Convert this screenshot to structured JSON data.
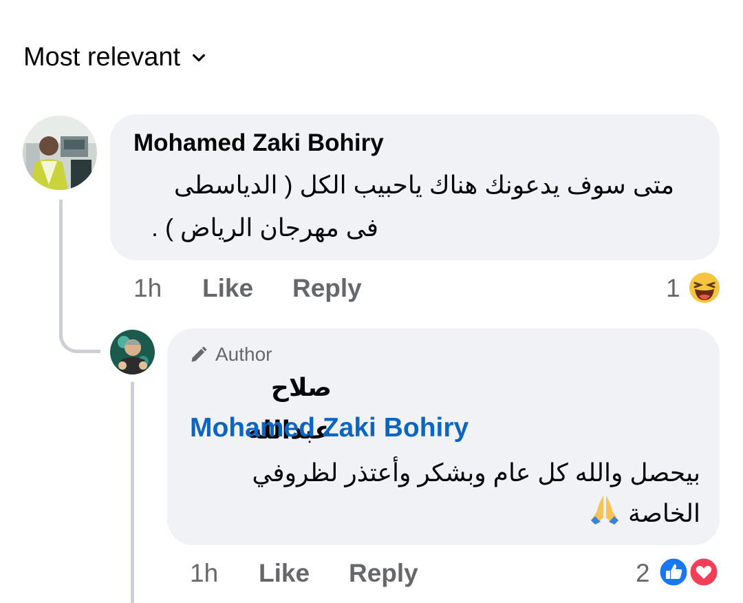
{
  "sort": {
    "label": "Most relevant"
  },
  "comment": {
    "author": "Mohamed Zaki Bohiry",
    "text_line1": "متى سوف يدعونك هناك ياحبيب الكل  ( الدياسطى",
    "text_line2": "فى مهرجان الرياض ) .",
    "time": "1h",
    "like_label": "Like",
    "reply_label": "Reply",
    "reaction_count": "1",
    "reactions": [
      "laugh-emoji"
    ]
  },
  "reply": {
    "badge_label": "Author",
    "author": "صلاح عبدالله",
    "mention": "Mohamed Zaki Bohiry",
    "text_line1": "بيحصل والله كل عام وبشكر وأعتذر لظروفي",
    "text_line2": "الخاصة",
    "emoji": "folded-hands-emoji",
    "time": "1h",
    "like_label": "Like",
    "reply_label": "Reply",
    "reaction_count": "2",
    "reactions": [
      "like-reaction",
      "love-reaction"
    ]
  },
  "colors": {
    "bubble": "#f0f2f5",
    "secondary_text": "#65676b",
    "mention_blue": "#0a66c2",
    "like_blue": "#1877f2",
    "love_red": "#f33e58"
  }
}
